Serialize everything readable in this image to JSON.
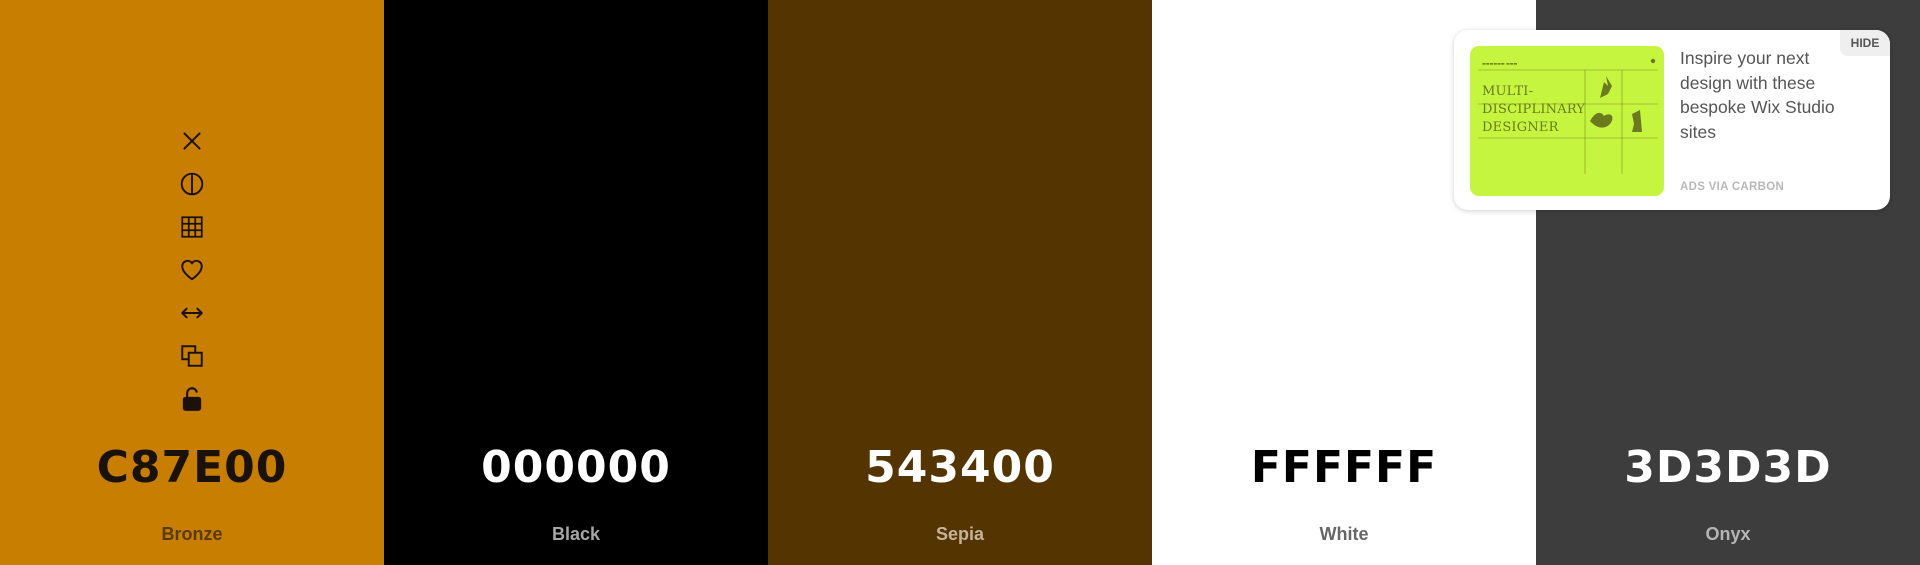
{
  "swatches": [
    {
      "hex": "C87E00",
      "name": "Bronze",
      "bg": "#C87E00",
      "hex_color": "#1a1208",
      "name_color": "#5a3a06"
    },
    {
      "hex": "000000",
      "name": "Black",
      "bg": "#000000",
      "hex_color": "#ffffff",
      "name_color": "#a6a6a6"
    },
    {
      "hex": "543400",
      "name": "Sepia",
      "bg": "#543400",
      "hex_color": "#ffffff",
      "name_color": "#c5b49a"
    },
    {
      "hex": "FFFFFF",
      "name": "White",
      "bg": "#FFFFFF",
      "hex_color": "#000000",
      "name_color": "#666666"
    },
    {
      "hex": "3D3D3D",
      "name": "Onyx",
      "bg": "#3D3D3D",
      "hex_color": "#ffffff",
      "name_color": "#b5b5b5"
    }
  ],
  "toolbar": {
    "icons": [
      "close-icon",
      "contrast-icon",
      "grid-icon",
      "heart-icon",
      "drag-horizontal-icon",
      "copy-icon",
      "unlock-icon"
    ]
  },
  "ad": {
    "text": "Inspire your next design with these bespoke Wix Studio sites",
    "via": "ADS VIA CARBON",
    "hide": "HIDE",
    "image_lines": [
      "MULTI-",
      "DISCIPLINARY",
      "DESIGNER"
    ],
    "image_bg": "#C6F53F",
    "image_ink": "#6B7A1E"
  }
}
